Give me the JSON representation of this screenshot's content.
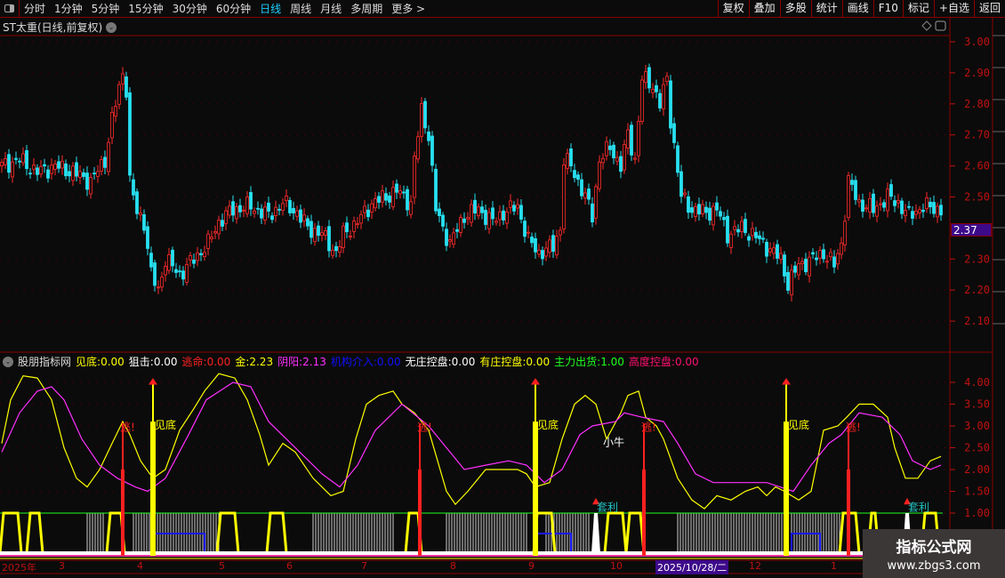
{
  "toolbar": {
    "periods": [
      "分时",
      "1分钟",
      "5分钟",
      "15分钟",
      "30分钟",
      "60分钟",
      "日线",
      "周线",
      "月线",
      "多周期",
      "更多 >"
    ],
    "active_period": "日线",
    "buttons": [
      "复权",
      "叠加",
      "多股",
      "统计",
      "画线",
      "F10",
      "标记",
      "+自选",
      "返回"
    ]
  },
  "title": "ST太重(日线,前复权)",
  "current_price": "2.37",
  "price_axis": [
    "3.00",
    "2.90",
    "2.80",
    "2.70",
    "2.60",
    "2.50",
    "2.30",
    "2.20",
    "2.10"
  ],
  "indicator_axis": [
    "4.00",
    "3.50",
    "3.00",
    "2.50",
    "2.00",
    "1.50",
    "1.00"
  ],
  "indicator": {
    "name": "股朋指标网",
    "fields": [
      {
        "label": "见底:",
        "value": "0.00",
        "color": "#ffff00"
      },
      {
        "label": "狙击:",
        "value": "0.00",
        "color": "#ffffff"
      },
      {
        "label": "逃命:",
        "value": "0.00",
        "color": "#ff2020"
      },
      {
        "label": "金:",
        "value": "2.23",
        "color": "#ffff00"
      },
      {
        "label": "阴阳:",
        "value": "2.13",
        "color": "#ff30ff"
      },
      {
        "label": "机构介入:",
        "value": "0.00",
        "color": "#1010ff"
      },
      {
        "label": "无庄控盘:",
        "value": "0.00",
        "color": "#ffffff"
      },
      {
        "label": "有庄控盘:",
        "value": "0.00",
        "color": "#ffff00"
      },
      {
        "label": "主力出货:",
        "value": "1.00",
        "color": "#20ff20"
      },
      {
        "label": "高度控盘:",
        "value": "0.00",
        "color": "#ff1070"
      }
    ],
    "signal_labels": {
      "bottom": "见底",
      "escape": "逃!",
      "bull": "小牛",
      "arbitrage": "套利"
    }
  },
  "time_axis": [
    {
      "label": "2025年",
      "day": 0
    },
    {
      "label": "3",
      "day": 16
    },
    {
      "label": "4",
      "day": 38
    },
    {
      "label": "5",
      "day": 61
    },
    {
      "label": "6",
      "day": 80
    },
    {
      "label": "7",
      "day": 101
    },
    {
      "label": "8",
      "day": 126
    },
    {
      "label": "9",
      "day": 148
    },
    {
      "label": "10",
      "day": 171
    },
    {
      "label": "12",
      "day": 210
    },
    {
      "label": "1",
      "day": 233
    }
  ],
  "cursor_date": "2025/10/28/二",
  "watermark": {
    "name": "指标公式网",
    "url": "www.zbgs3.com"
  },
  "colors": {
    "up": "#ff2b2b",
    "down": "#27e0f0",
    "yellow": "#ffff00",
    "magenta": "#ff30ff",
    "axis": "#c01010"
  },
  "chart_data": {
    "type": "candlestick",
    "price_path": [
      [
        0,
        2.6
      ],
      [
        5,
        2.62
      ],
      [
        10,
        2.58
      ],
      [
        15,
        2.6
      ],
      [
        20,
        2.58
      ],
      [
        25,
        2.55
      ],
      [
        29,
        2.62
      ],
      [
        31,
        2.75
      ],
      [
        34,
        2.9
      ],
      [
        35,
        2.85
      ],
      [
        36,
        2.55
      ],
      [
        38,
        2.45
      ],
      [
        40,
        2.42
      ],
      [
        42,
        2.25
      ],
      [
        44,
        2.2
      ],
      [
        46,
        2.3
      ],
      [
        50,
        2.25
      ],
      [
        54,
        2.3
      ],
      [
        58,
        2.35
      ],
      [
        61,
        2.42
      ],
      [
        65,
        2.46
      ],
      [
        70,
        2.47
      ],
      [
        75,
        2.44
      ],
      [
        79,
        2.48
      ],
      [
        83,
        2.45
      ],
      [
        86,
        2.4
      ],
      [
        90,
        2.38
      ],
      [
        94,
        2.32
      ],
      [
        96,
        2.38
      ],
      [
        100,
        2.42
      ],
      [
        104,
        2.48
      ],
      [
        108,
        2.5
      ],
      [
        111,
        2.52
      ],
      [
        115,
        2.48
      ],
      [
        116,
        2.62
      ],
      [
        118,
        2.78
      ],
      [
        120,
        2.7
      ],
      [
        122,
        2.46
      ],
      [
        124,
        2.4
      ],
      [
        126,
        2.35
      ],
      [
        130,
        2.44
      ],
      [
        134,
        2.46
      ],
      [
        138,
        2.42
      ],
      [
        141,
        2.45
      ],
      [
        145,
        2.47
      ],
      [
        148,
        2.36
      ],
      [
        151,
        2.32
      ],
      [
        155,
        2.34
      ],
      [
        157,
        2.4
      ],
      [
        158,
        2.62
      ],
      [
        160,
        2.6
      ],
      [
        164,
        2.5
      ],
      [
        166,
        2.44
      ],
      [
        168,
        2.62
      ],
      [
        171,
        2.66
      ],
      [
        174,
        2.6
      ],
      [
        176,
        2.7
      ],
      [
        178,
        2.62
      ],
      [
        180,
        2.88
      ],
      [
        183,
        2.86
      ],
      [
        185,
        2.8
      ],
      [
        187,
        2.88
      ],
      [
        188,
        2.75
      ],
      [
        191,
        2.5
      ],
      [
        194,
        2.46
      ],
      [
        198,
        2.45
      ],
      [
        201,
        2.46
      ],
      [
        204,
        2.38
      ],
      [
        208,
        2.4
      ],
      [
        211,
        2.38
      ],
      [
        215,
        2.34
      ],
      [
        219,
        2.3
      ],
      [
        221,
        2.22
      ],
      [
        224,
        2.28
      ],
      [
        228,
        2.3
      ],
      [
        231,
        2.32
      ],
      [
        234,
        2.28
      ],
      [
        236,
        2.35
      ],
      [
        238,
        2.55
      ],
      [
        241,
        2.48
      ],
      [
        245,
        2.46
      ],
      [
        249,
        2.5
      ],
      [
        252,
        2.48
      ],
      [
        255,
        2.44
      ],
      [
        259,
        2.47
      ],
      [
        264,
        2.46
      ]
    ],
    "yellow_line": [
      [
        0,
        2.6
      ],
      [
        2.5,
        3.6
      ],
      [
        6,
        4.15
      ],
      [
        10,
        4.1
      ],
      [
        14,
        3.6
      ],
      [
        17.5,
        2.5
      ],
      [
        21,
        1.8
      ],
      [
        24,
        1.6
      ],
      [
        27.5,
        2.0
      ],
      [
        31,
        2.6
      ],
      [
        34,
        3.1
      ],
      [
        36,
        2.8
      ],
      [
        39,
        2.2
      ],
      [
        42.5,
        1.8
      ],
      [
        46,
        2.0
      ],
      [
        50,
        2.9
      ],
      [
        54,
        3.4
      ],
      [
        57,
        3.8
      ],
      [
        61,
        4.2
      ],
      [
        65.5,
        4.1
      ],
      [
        69,
        3.6
      ],
      [
        72.5,
        2.8
      ],
      [
        75,
        2.1
      ],
      [
        79,
        2.6
      ],
      [
        82.5,
        2.4
      ],
      [
        87.5,
        1.8
      ],
      [
        92.5,
        1.4
      ],
      [
        96,
        1.5
      ],
      [
        99.5,
        2.7
      ],
      [
        102.5,
        3.5
      ],
      [
        106,
        3.7
      ],
      [
        110,
        3.8
      ],
      [
        112.5,
        3.5
      ],
      [
        116,
        3.3
      ],
      [
        120,
        2.9
      ],
      [
        122.5,
        2.2
      ],
      [
        125,
        1.5
      ],
      [
        127.5,
        1.2
      ],
      [
        131,
        1.5
      ],
      [
        136,
        2.0
      ],
      [
        141,
        2.0
      ],
      [
        145,
        2.0
      ],
      [
        147.5,
        1.9
      ],
      [
        150,
        1.6
      ],
      [
        154,
        1.7
      ],
      [
        157.5,
        2.7
      ],
      [
        161,
        3.5
      ],
      [
        164,
        3.7
      ],
      [
        167,
        3.5
      ],
      [
        170,
        2.7
      ],
      [
        174,
        3.3
      ],
      [
        176,
        3.7
      ],
      [
        179,
        3.8
      ],
      [
        181,
        3.2
      ],
      [
        184,
        3.0
      ],
      [
        186,
        2.7
      ],
      [
        190,
        1.8
      ],
      [
        194,
        1.3
      ],
      [
        197.5,
        1.1
      ],
      [
        201,
        1.4
      ],
      [
        205,
        1.3
      ],
      [
        209,
        1.5
      ],
      [
        212.5,
        1.6
      ],
      [
        215,
        1.4
      ],
      [
        217.5,
        1.6
      ],
      [
        220,
        1.5
      ],
      [
        224,
        1.3
      ],
      [
        227.5,
        1.5
      ],
      [
        231,
        2.9
      ],
      [
        235,
        3.0
      ],
      [
        237.5,
        3.2
      ],
      [
        241,
        3.5
      ],
      [
        245,
        3.5
      ],
      [
        249,
        3.2
      ],
      [
        251,
        2.5
      ],
      [
        254,
        1.8
      ],
      [
        257.5,
        1.8
      ],
      [
        261,
        2.2
      ],
      [
        264,
        2.3
      ]
    ],
    "magenta_line": [
      [
        0,
        2.4
      ],
      [
        5,
        3.3
      ],
      [
        10,
        3.8
      ],
      [
        14,
        3.9
      ],
      [
        17.5,
        3.6
      ],
      [
        22.5,
        2.7
      ],
      [
        27.5,
        2.1
      ],
      [
        32.5,
        1.8
      ],
      [
        37.5,
        1.6
      ],
      [
        41,
        1.5
      ],
      [
        46,
        1.8
      ],
      [
        52.5,
        2.8
      ],
      [
        57.5,
        3.6
      ],
      [
        65,
        4.0
      ],
      [
        70,
        3.9
      ],
      [
        75,
        3.1
      ],
      [
        80,
        2.7
      ],
      [
        85,
        2.3
      ],
      [
        90,
        1.9
      ],
      [
        95,
        1.6
      ],
      [
        100,
        2.1
      ],
      [
        105,
        2.9
      ],
      [
        112.5,
        3.5
      ],
      [
        120,
        3.0
      ],
      [
        125,
        2.5
      ],
      [
        130,
        2.0
      ],
      [
        136,
        2.1
      ],
      [
        142.5,
        2.2
      ],
      [
        147.5,
        2.1
      ],
      [
        152.5,
        1.7
      ],
      [
        157.5,
        2.0
      ],
      [
        162.5,
        2.8
      ],
      [
        166,
        3.0
      ],
      [
        172.5,
        3.1
      ],
      [
        175,
        3.3
      ],
      [
        180,
        3.2
      ],
      [
        186,
        3.1
      ],
      [
        190,
        2.6
      ],
      [
        195,
        1.9
      ],
      [
        200,
        1.7
      ],
      [
        205,
        1.7
      ],
      [
        215,
        1.7
      ],
      [
        222.5,
        1.5
      ],
      [
        227.5,
        2.1
      ],
      [
        232.5,
        2.6
      ],
      [
        236,
        2.8
      ],
      [
        241,
        3.3
      ],
      [
        247.5,
        3.2
      ],
      [
        252.5,
        2.8
      ],
      [
        256,
        2.2
      ],
      [
        261,
        2.0
      ],
      [
        264,
        2.1
      ]
    ],
    "bottom_signals": [
      42.5,
      150,
      220.5
    ],
    "escape_signals": [
      34,
      117.5,
      180.5,
      238
    ],
    "arbitrage_signals": [
      167,
      254.5
    ],
    "bull_signal": [
      169.5,
      2.6
    ],
    "white_zones": [
      [
        24,
        29
      ],
      [
        37,
        61
      ],
      [
        87.5,
        110
      ],
      [
        125,
        147.5
      ],
      [
        153,
        165
      ],
      [
        190,
        220
      ],
      [
        222,
        236
      ]
    ],
    "yellow_zones": [
      [
        0,
        5
      ],
      [
        7.5,
        11
      ],
      [
        30,
        34
      ],
      [
        61,
        66
      ],
      [
        75,
        79.5
      ],
      [
        114,
        117.5
      ],
      [
        150,
        155
      ],
      [
        170,
        175
      ],
      [
        176,
        180
      ],
      [
        236,
        240.5
      ],
      [
        244,
        246
      ],
      [
        259,
        263
      ]
    ],
    "blue_zones": [
      [
        42,
        57
      ],
      [
        150,
        160
      ],
      [
        222,
        230
      ]
    ]
  }
}
